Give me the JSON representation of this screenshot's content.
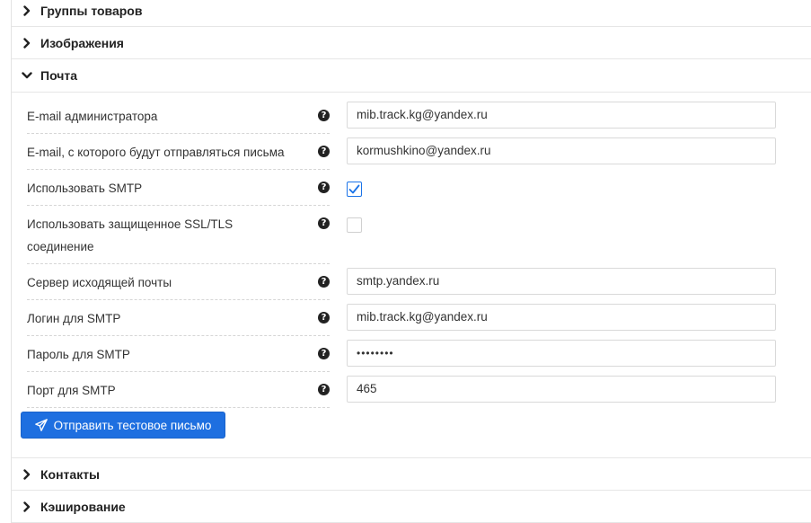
{
  "sections": [
    {
      "title": "Группы товаров",
      "state": "collapsed"
    },
    {
      "title": "Изображения",
      "state": "collapsed"
    },
    {
      "title": "Почта",
      "state": "expanded"
    },
    {
      "title": "Контакты",
      "state": "collapsed"
    },
    {
      "title": "Кэширование",
      "state": "collapsed"
    }
  ],
  "mail": {
    "admin_email_label": "E-mail администратора",
    "admin_email_value": "mib.track.kg@yandex.ru",
    "from_email_label": "E-mail, с которого будут отправляться письма",
    "from_email_value": "kormushkino@yandex.ru",
    "use_smtp_label": "Использовать SMTP",
    "use_smtp_checked": true,
    "use_ssl_label": "Использовать защищенное SSL/TLS соединение",
    "use_ssl_checked": false,
    "smtp_server_label": "Сервер исходящей почты",
    "smtp_server_value": "smtp.yandex.ru",
    "smtp_login_label": "Логин для SMTP",
    "smtp_login_value": "mib.track.kg@yandex.ru",
    "smtp_password_label": "Пароль для SMTP",
    "smtp_password_value": "••••••••",
    "smtp_port_label": "Порт для SMTP",
    "smtp_port_value": "465",
    "send_test_label": "Отправить тестовое письмо"
  },
  "help_glyph": "?",
  "icons": {
    "collapsed": "chevron-right-icon",
    "expanded": "chevron-down-icon",
    "help": "question-circle-icon",
    "send": "paper-plane-icon"
  },
  "colors": {
    "accent": "#1e6fe0",
    "checkbox_checked_border": "#1a73e8"
  }
}
